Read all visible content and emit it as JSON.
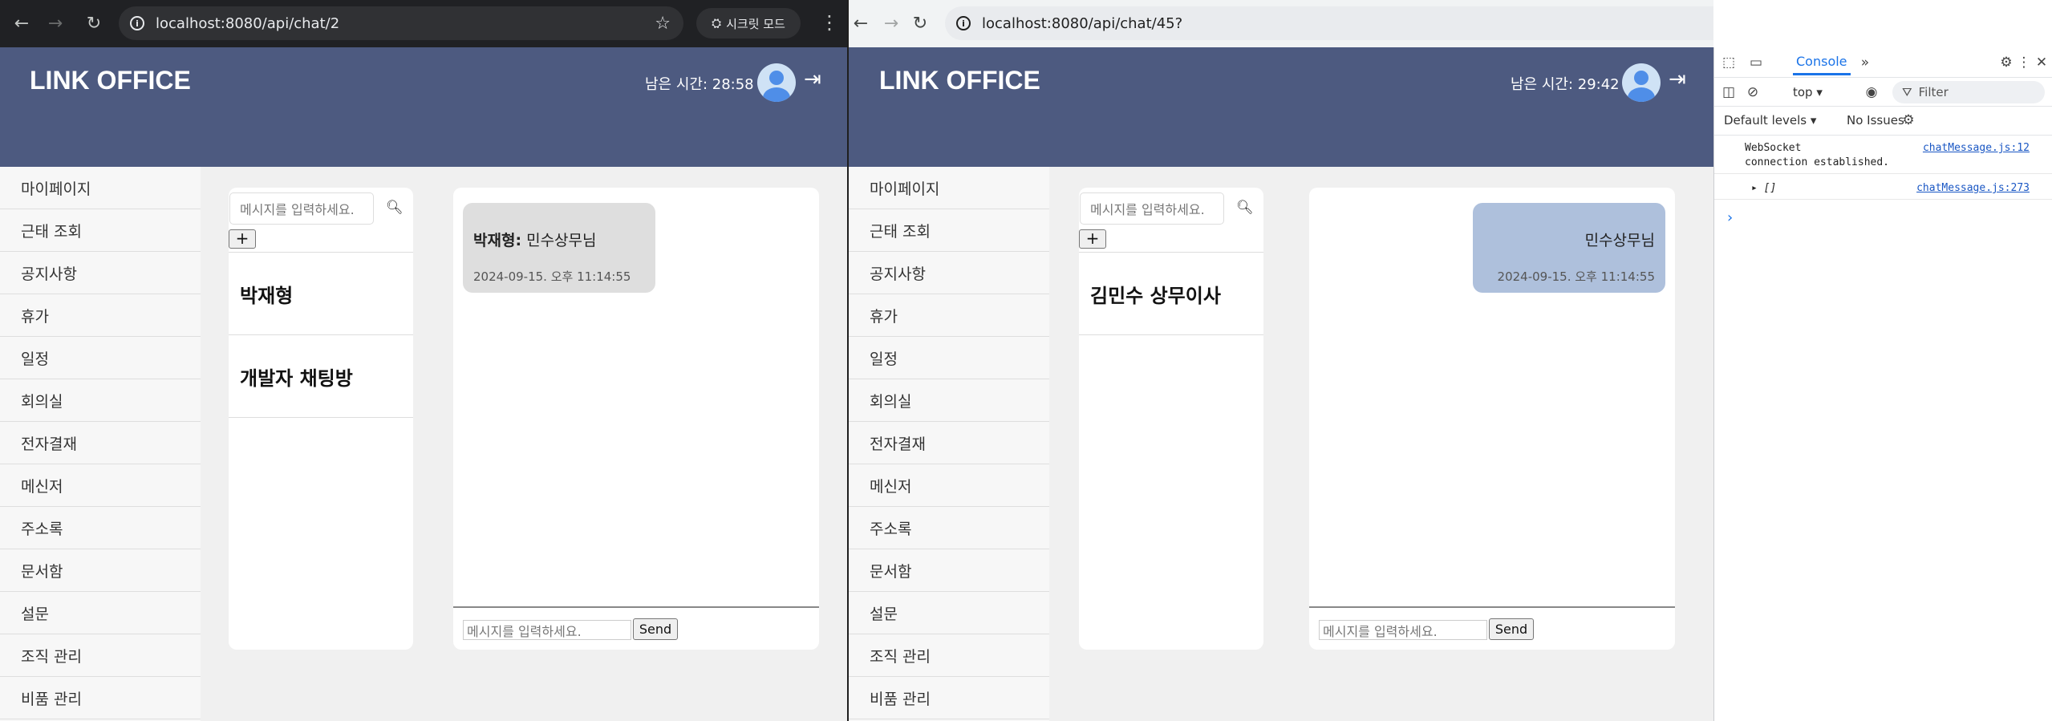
{
  "left_window": {
    "url": "localhost:8080/api/chat/2",
    "incognito_label": "시크릿 모드",
    "app": {
      "logo": "LINK OFFICE",
      "timer": "남은 시간: 28:58",
      "search_placeholder": "메시지를 입력하세요.",
      "add_label": "+",
      "rooms": [
        "박재형",
        "개발자 채팅방"
      ],
      "message": {
        "sender": "박재형:",
        "text": "민수상무님",
        "timestamp": "2024-09-15. 오후 11:14:55"
      },
      "input_placeholder": "메시지를 입력하세요.",
      "send_label": "Send"
    }
  },
  "right_window": {
    "url": "localhost:8080/api/chat/45?",
    "app": {
      "logo": "LINK OFFICE",
      "timer": "남은 시간: 29:42",
      "search_placeholder": "메시지를 입력하세요.",
      "add_label": "+",
      "rooms": [
        "김민수 상무이사"
      ],
      "message": {
        "text": "민수상무님",
        "timestamp": "2024-09-15. 오후 11:14:55"
      },
      "input_placeholder": "메시지를 입력하세요.",
      "send_label": "Send"
    }
  },
  "sidebar": [
    "마이페이지",
    "근태 조회",
    "공지사항",
    "휴가",
    "일정",
    "회의실",
    "전자결재",
    "메신저",
    "주소록",
    "문서함",
    "설문",
    "조직 관리",
    "비품 관리"
  ],
  "devtools": {
    "tab": "Console",
    "context": "top ▾",
    "filter": "Filter",
    "levels": "Default levels ▾",
    "issues": "No Issues",
    "log1_line1": "WebSocket",
    "log1_line2": "connection established.",
    "log1_source": "chatMessage.js:12",
    "log2_text": "▸ []",
    "log2_source": "chatMessage.js:273",
    "prompt": "›"
  },
  "colors": {
    "header": "#4d5a80",
    "mine_bubble": "#aec0dc",
    "other_bubble": "#dedede",
    "incognito_toolbar": "#202124"
  }
}
